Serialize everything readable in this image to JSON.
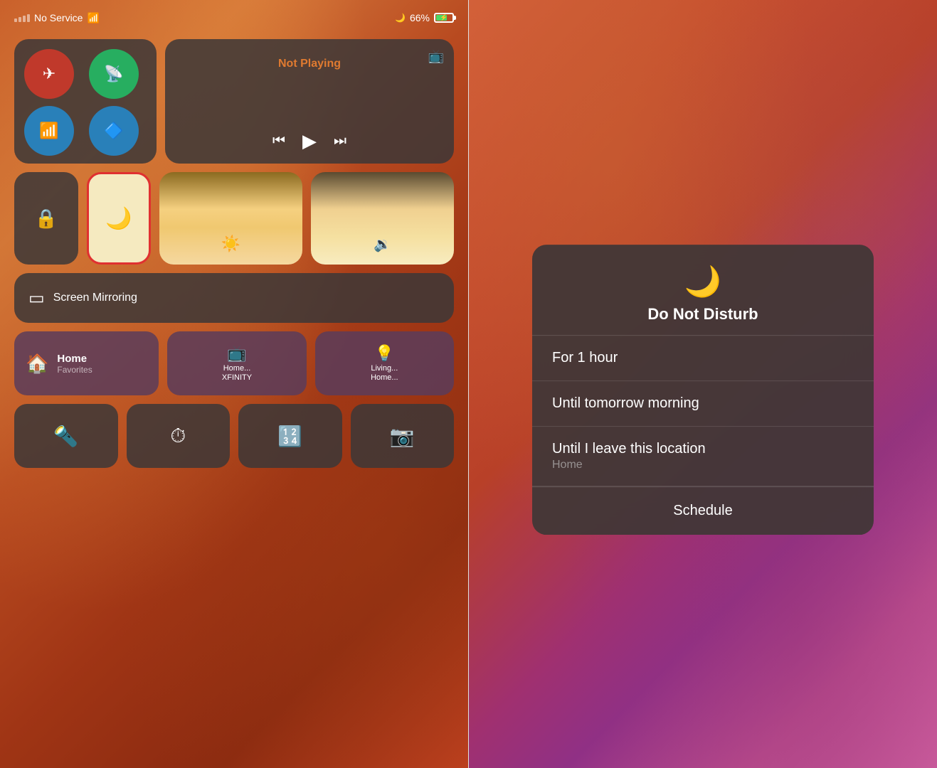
{
  "left": {
    "status": {
      "signal_label": "No Service",
      "wifi": "wifi",
      "battery_pct": "66%",
      "moon": "🌙"
    },
    "tiles": {
      "airplane_label": "airplane",
      "wifi_label": "wifi",
      "cellular_label": "cellular",
      "bluetooth_label": "bluetooth",
      "not_playing": "Not Playing",
      "screen_mirroring": "Screen Mirroring",
      "home": "Home",
      "favorites": "Favorites",
      "home_xfinity_name": "Home...",
      "home_xfinity_sub": "XFINITY",
      "living_name": "Living...",
      "living_sub": "Home..."
    }
  },
  "right": {
    "dnd": {
      "title": "Do Not Disturb",
      "option1": "For 1 hour",
      "option2": "Until tomorrow morning",
      "option3": "Until I leave this location",
      "option3_sub": "Home",
      "schedule": "Schedule"
    }
  }
}
